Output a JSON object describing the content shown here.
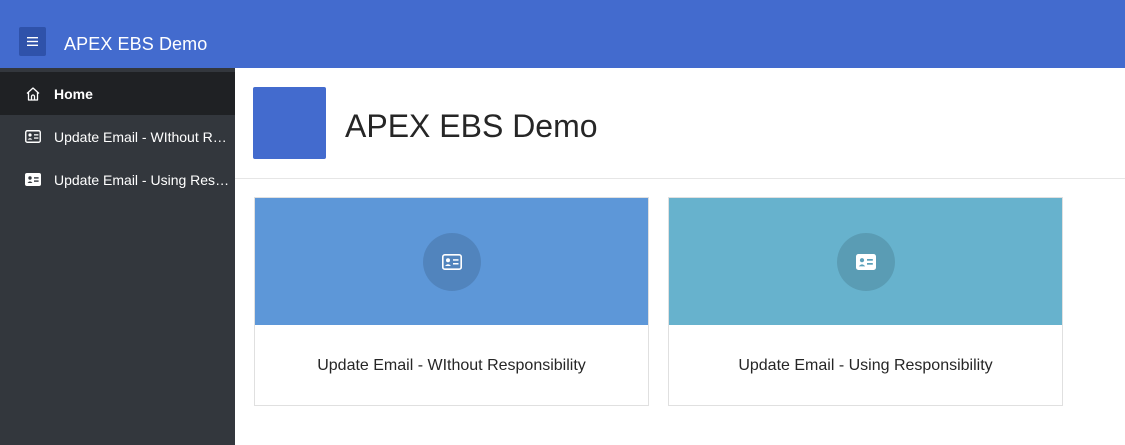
{
  "header": {
    "menu_icon": "hamburger-icon",
    "title": "APEX EBS Demo",
    "color": "#436bce"
  },
  "sidebar": {
    "items": [
      {
        "label": "Home",
        "icon": "home-icon",
        "active": true
      },
      {
        "label": "Update Email - WIthout Responsibility",
        "icon": "id-card-outline-icon",
        "active": false
      },
      {
        "label": "Update Email - Using Responsibility",
        "icon": "id-card-solid-icon",
        "active": false
      }
    ],
    "background": "#33373d",
    "active_background": "#1f2124"
  },
  "main": {
    "hero": {
      "title": "APEX EBS Demo",
      "icon_color": "#436bce"
    },
    "cards": [
      {
        "title": "Update Email - WIthout Responsibility",
        "icon": "id-card-outline-icon",
        "color": "#5d97d8"
      },
      {
        "title": "Update Email - Using Responsibility",
        "icon": "id-card-solid-icon",
        "color": "#67b2cd"
      }
    ]
  }
}
